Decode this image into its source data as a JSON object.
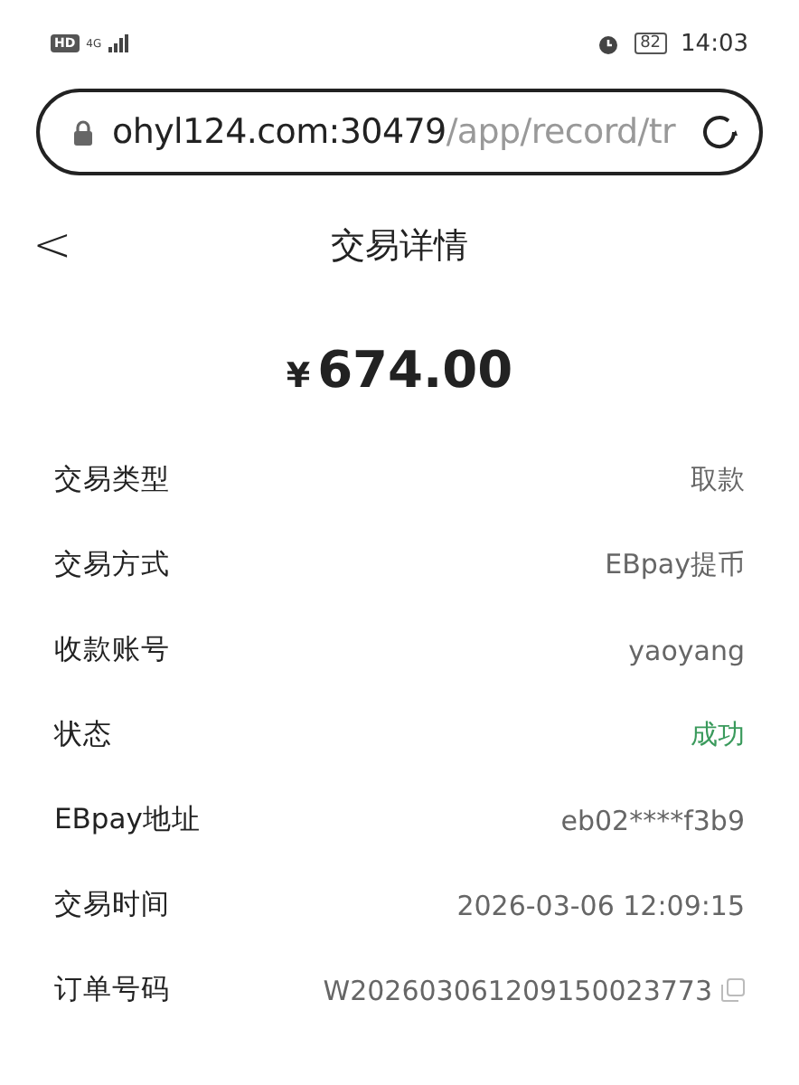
{
  "status_bar": {
    "hd": "HD",
    "network": "4G",
    "battery": "82",
    "time": "14:03"
  },
  "address_bar": {
    "host": "ohyl124.com:30479",
    "path": "/app/record/tr"
  },
  "header": {
    "back": "<",
    "title": "交易详情"
  },
  "amount": {
    "currency": "¥",
    "value": "674.00"
  },
  "rows": [
    {
      "kind": "text",
      "label": "交易类型",
      "value": "取款"
    },
    {
      "kind": "text",
      "label": "交易方式",
      "value": "EBpay提币"
    },
    {
      "kind": "text",
      "label": "收款账号",
      "value": "yaoyang"
    },
    {
      "kind": "status",
      "label": "状态",
      "value": "成功",
      "color": "#3a9a5c"
    },
    {
      "kind": "text",
      "label": "EBpay地址",
      "value": "eb02****f3b9"
    },
    {
      "kind": "text",
      "label": "交易时间",
      "value": "2026-03-06 12:09:15"
    },
    {
      "kind": "copy",
      "label": "订单号码",
      "value": "W202603061209150023773"
    }
  ]
}
